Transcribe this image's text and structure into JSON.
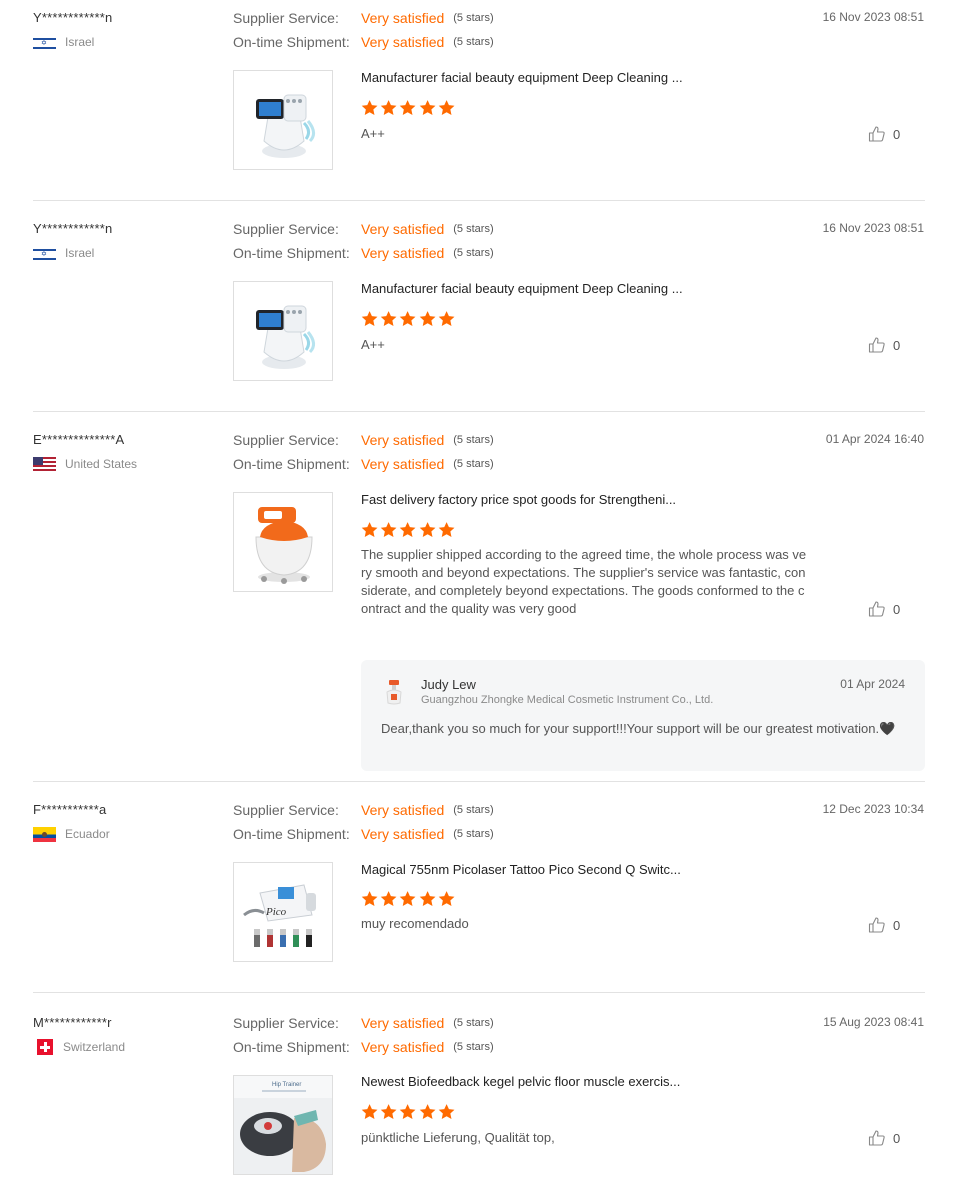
{
  "labels": {
    "supplier_service": "Supplier Service:",
    "ontime_shipment": "On-time Shipment:",
    "rating_value": "Very satisfied",
    "rating_stars": "(5 stars)"
  },
  "colors": {
    "accent": "#ff6a00",
    "divider": "#e2e2e2",
    "reply_bg": "#f5f6f7"
  },
  "reviews": [
    {
      "buyer": "Y************n",
      "country": "Israel",
      "flag_icon": "israel-flag-icon",
      "date": "16 Nov 2023 08:51",
      "product_title": "Manufacturer facial beauty equipment Deep Cleaning ...",
      "product_rating": 5,
      "text": "A++",
      "likes": "0"
    },
    {
      "buyer": "Y************n",
      "country": "Israel",
      "flag_icon": "israel-flag-icon",
      "date": "16 Nov 2023 08:51",
      "product_title": "Manufacturer facial beauty equipment Deep Cleaning ...",
      "product_rating": 5,
      "text": "A++",
      "likes": "0"
    },
    {
      "buyer": "E**************A",
      "country": "United States",
      "flag_icon": "united-states-flag-icon",
      "date": "01 Apr 2024 16:40",
      "product_title": "Fast delivery factory price spot goods for Strengtheni...",
      "product_rating": 5,
      "text": "The supplier shipped according to the agreed time, the whole process was very smooth and beyond expectations. The supplier's service was fantastic, considerate, and completely beyond expectations. The goods conformed to the contract and the quality was very good",
      "likes": "0",
      "reply": {
        "name": "Judy Lew",
        "company": "Guangzhou Zhongke Medical Cosmetic Instrument Co., Ltd.",
        "date": "01 Apr 2024",
        "text": "Dear,thank you so much for your support!!!Your support will be our greatest motivation.🖤"
      }
    },
    {
      "buyer": "F***********a",
      "country": "Ecuador",
      "flag_icon": "ecuador-flag-icon",
      "date": "12 Dec 2023 10:34",
      "product_title": "Magical 755nm Picolaser Tattoo Pico Second Q Switc...",
      "product_rating": 5,
      "text": "muy recomendado",
      "likes": "0",
      "image_caption": "Pico"
    },
    {
      "buyer": "M************r",
      "country": "Switzerland",
      "flag_icon": "switzerland-flag-icon",
      "date": "15 Aug 2023 08:41",
      "product_title": "Newest Biofeedback kegel pelvic floor muscle exercis...",
      "product_rating": 5,
      "text": "pünktliche Lieferung, Qualität top,",
      "likes": "0",
      "image_caption": "Hip Trainer"
    }
  ]
}
